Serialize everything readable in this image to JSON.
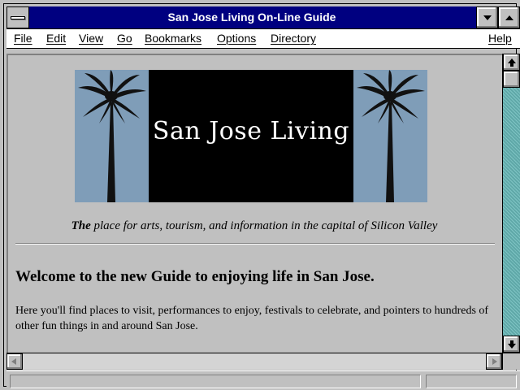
{
  "window": {
    "title": "San Jose Living On-Line Guide"
  },
  "menu": {
    "file": "File",
    "edit": "Edit",
    "view": "View",
    "go": "Go",
    "bookmarks": "Bookmarks",
    "options": "Options",
    "directory": "Directory",
    "help": "Help"
  },
  "page": {
    "banner_text": "San Jose Living",
    "tagline_bold": "The",
    "tagline_rest": " place for arts, tourism, and information in the capital of Silicon Valley",
    "heading": "Welcome to the new Guide to enjoying life in San Jose.",
    "paragraph": "Here you'll find places to visit, performances to enjoy, festivals to celebrate, and pointers to hundreds of other fun things in and around San Jose."
  },
  "status": {
    "text": "",
    "progress": ""
  },
  "colors": {
    "titlebar": "#000080",
    "chrome": "#c0c0c0",
    "banner_black": "#000000",
    "banner_palm_bg": "#7f9db8",
    "scroll_track": "#5fa8a8"
  },
  "icons": [
    "system-menu-icon",
    "minimize-icon",
    "maximize-icon",
    "palm-tree-icon",
    "scroll-up-icon",
    "scroll-down-icon",
    "scroll-left-icon",
    "scroll-right-icon"
  ]
}
